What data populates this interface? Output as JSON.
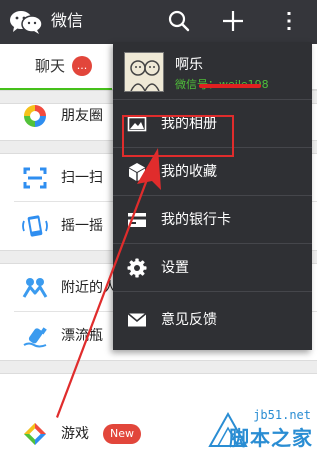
{
  "header": {
    "title": "微信",
    "icons": [
      "wechat-logo-icon",
      "search-icon",
      "add-icon",
      "more-vertical-icon"
    ]
  },
  "tabs": {
    "chat_label": "聊天",
    "chat_badge": "..."
  },
  "discover": {
    "items": [
      {
        "label": "朋友圈",
        "icon": "moments-icon"
      },
      {
        "label": "扫一扫",
        "icon": "scan-icon"
      },
      {
        "label": "摇一摇",
        "icon": "shake-icon"
      },
      {
        "label": "附近的人",
        "icon": "people-nearby-icon"
      },
      {
        "label": "漂流瓶",
        "icon": "drift-bottle-icon"
      },
      {
        "label": "游戏",
        "icon": "games-icon",
        "badge": "New"
      }
    ]
  },
  "menu": {
    "profile": {
      "name": "啊乐",
      "wechat_id": "微信号：weile198"
    },
    "items": [
      {
        "label": "我的相册",
        "icon": "album-icon"
      },
      {
        "label": "我的收藏",
        "icon": "favorites-icon"
      },
      {
        "label": "我的银行卡",
        "icon": "bank-card-icon"
      },
      {
        "label": "设置",
        "icon": "settings-icon"
      },
      {
        "label": "意见反馈",
        "icon": "feedback-icon"
      }
    ]
  },
  "watermark": {
    "site": "jb51.net",
    "brand": "脚本之家"
  },
  "colors": {
    "topbar": "#35363b",
    "accent_green": "#45c01a",
    "menu_bg": "#2f3034",
    "badge_red": "#e2463b",
    "annotation_red": "#e02c2c",
    "watermark_blue": "#2a8dd3"
  }
}
